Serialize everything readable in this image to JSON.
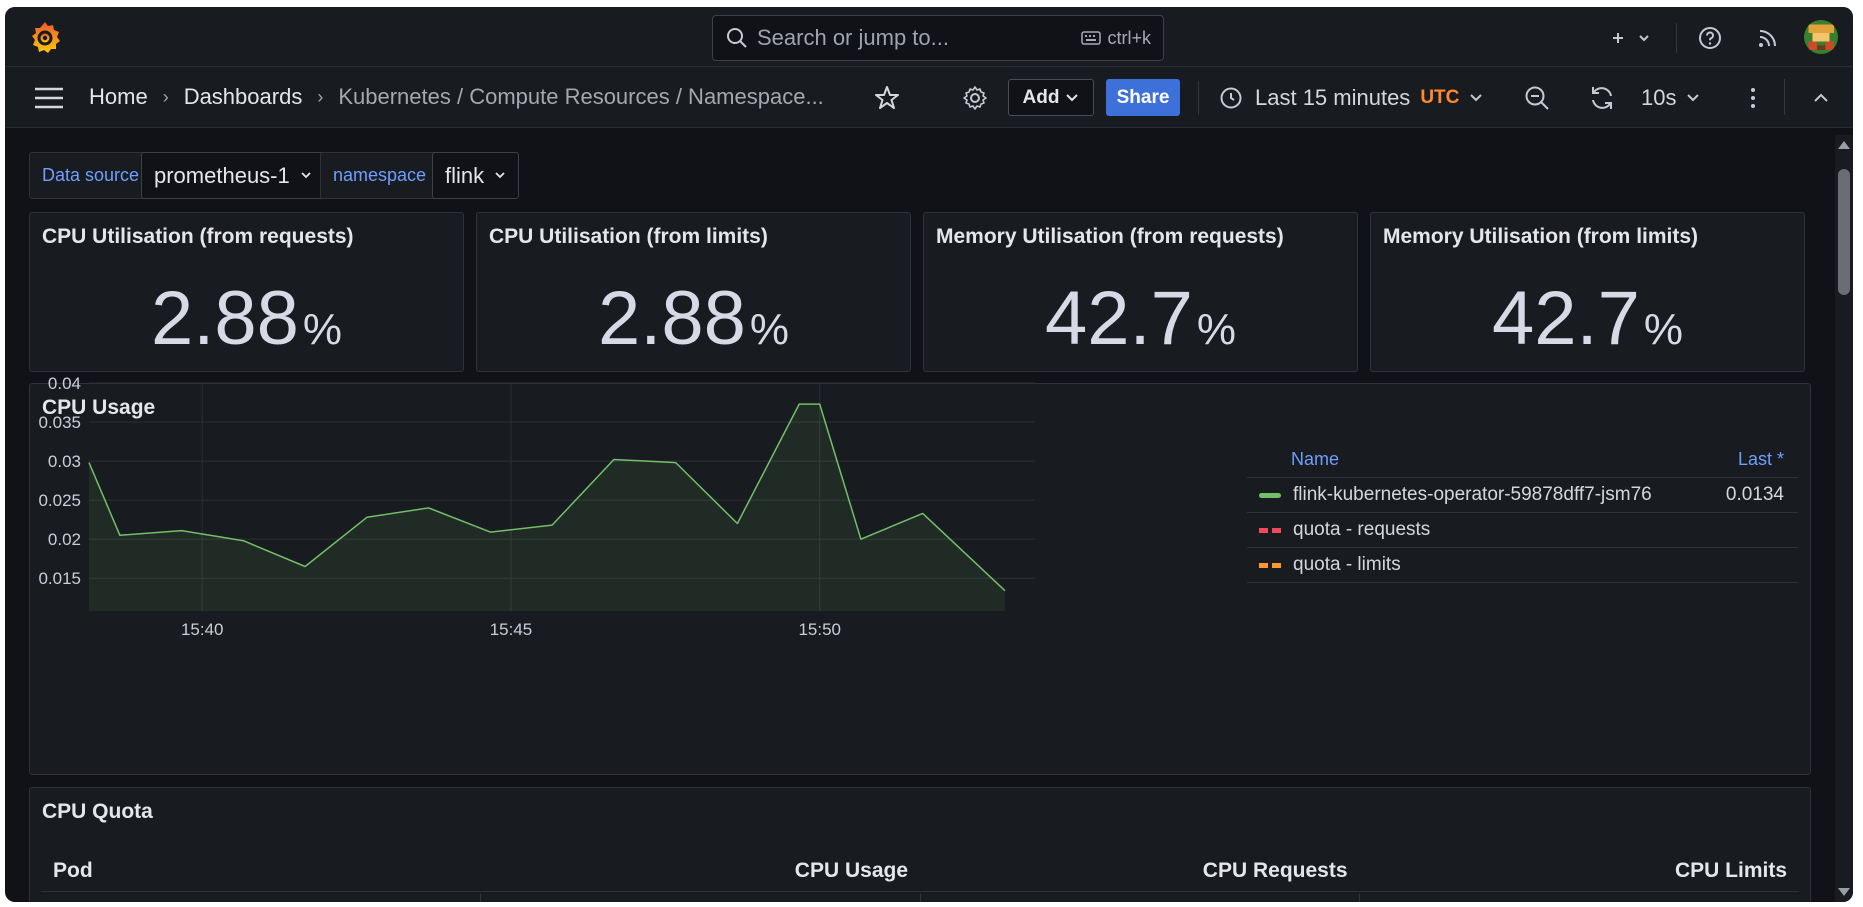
{
  "topbar": {
    "search_placeholder": "Search or jump to...",
    "search_shortcut": "ctrl+k"
  },
  "navbar": {
    "breadcrumbs": [
      "Home",
      "Dashboards",
      "Kubernetes / Compute Resources / Namespace..."
    ],
    "add_label": "Add",
    "share_label": "Share",
    "time_range": "Last 15 minutes",
    "timezone": "UTC",
    "refresh_interval": "10s"
  },
  "variables": [
    {
      "label": "Data source",
      "value": "prometheus-1"
    },
    {
      "label": "namespace",
      "value": "flink"
    }
  ],
  "stats": [
    {
      "title": "CPU Utilisation (from requests)",
      "value": "2.88",
      "unit": "%"
    },
    {
      "title": "CPU Utilisation (from limits)",
      "value": "2.88",
      "unit": "%"
    },
    {
      "title": "Memory Utilisation (from requests)",
      "value": "42.7",
      "unit": "%"
    },
    {
      "title": "Memory Utilisation (from limits)",
      "value": "42.7",
      "unit": "%"
    }
  ],
  "cpu_usage_panel": {
    "title": "CPU Usage",
    "legend": {
      "col_name": "Name",
      "col_last": "Last *",
      "rows": [
        {
          "name": "flink-kubernetes-operator-59878dff7-jsm76",
          "last": "0.0134",
          "color": "#73bf69",
          "style": "solid"
        },
        {
          "name": "quota - requests",
          "last": "",
          "color": "#f2495c",
          "style": "dashed"
        },
        {
          "name": "quota - limits",
          "last": "",
          "color": "#ff9830",
          "style": "dashed"
        }
      ]
    }
  },
  "chart_data": {
    "type": "area",
    "title": "CPU Usage",
    "xlabel": "",
    "ylabel": "",
    "ylim": [
      0.0108,
      0.04
    ],
    "xlim": [
      "15:38:10",
      "15:53:00"
    ],
    "yticks": [
      "0.04",
      "0.035",
      "0.03",
      "0.025",
      "0.02",
      "0.015"
    ],
    "xticks": [
      "15:40",
      "15:45",
      "15:50"
    ],
    "grid": true,
    "legend_position": "right",
    "series": [
      {
        "name": "flink-kubernetes-operator-59878dff7-jsm76",
        "color": "#73bf69",
        "x": [
          "15:38:10",
          "15:38:40",
          "15:39:40",
          "15:40:40",
          "15:41:40",
          "15:42:40",
          "15:43:40",
          "15:44:40",
          "15:45:40",
          "15:46:40",
          "15:47:40",
          "15:48:40",
          "15:49:40",
          "15:50:00",
          "15:50:40",
          "15:51:40",
          "15:53:00"
        ],
        "values": [
          0.0298,
          0.0205,
          0.0211,
          0.0198,
          0.0165,
          0.0228,
          0.024,
          0.0209,
          0.0218,
          0.0302,
          0.0298,
          0.022,
          0.0373,
          0.0373,
          0.02,
          0.0233,
          0.0134
        ]
      }
    ]
  },
  "cpu_quota_panel": {
    "title": "CPU Quota",
    "columns": [
      "Pod",
      "CPU Usage",
      "CPU Requests",
      "CPU Limits"
    ]
  },
  "colors": {
    "accent_blue": "#3d71d9",
    "utc_orange": "#ff8a2e",
    "series_green": "#73bf69",
    "link_blue": "#6e9fff"
  },
  "icons": [
    "grafana-logo",
    "search-icon",
    "keyboard-icon",
    "plus-icon",
    "help-icon",
    "rss-icon",
    "avatar",
    "menu-icon",
    "star-icon",
    "gear-icon",
    "clock-icon",
    "zoom-out-icon",
    "refresh-icon",
    "kebab-icon",
    "chevron-up-icon"
  ]
}
